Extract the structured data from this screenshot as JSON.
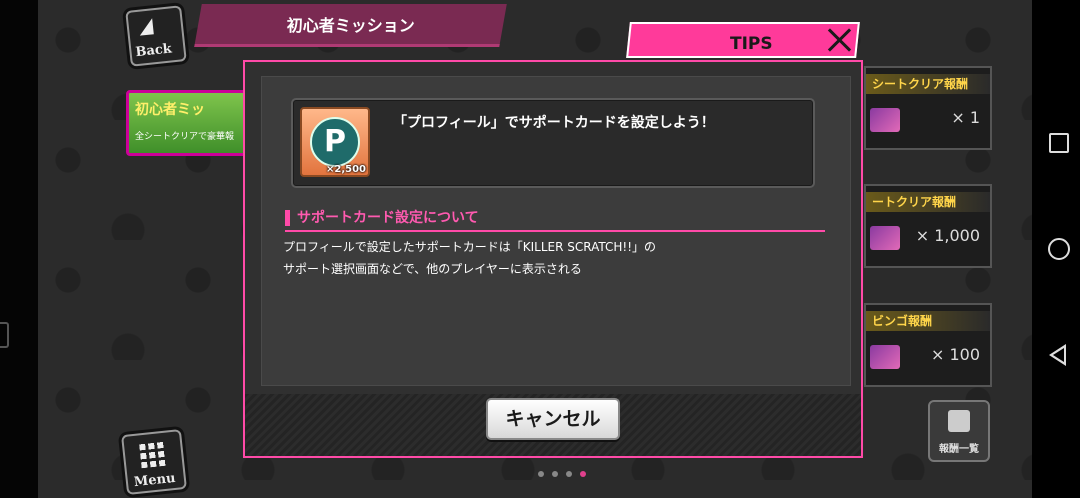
{
  "background": {
    "back_label": "Back",
    "title": "初心者ミッション",
    "mission_banner_title": "初心者ミッ",
    "mission_banner_sub": "全シートクリアで豪華報",
    "menu_label": "Menu",
    "reward_list_label": "報酬一覧",
    "reward_cards": [
      {
        "header": "シートクリア報酬",
        "quantity": "× 1"
      },
      {
        "header": "ートクリア報酬",
        "quantity": "× 1,000"
      },
      {
        "header": "ビンゴ報酬",
        "quantity": "× 100"
      }
    ],
    "page_dots": 4,
    "active_dot": 3
  },
  "tips": {
    "tab_label": "TIPS",
    "close_icon": "close-icon"
  },
  "modal": {
    "item_symbol": "P",
    "item_count": "×2,500",
    "mission_text": "「プロフィール」でサポートカードを設定しよう！",
    "section_title": "サポートカード設定について",
    "desc_line1": "プロフィールで設定したサポートカードは「KILLER SCRATCH!!」の",
    "desc_line2": "サポート選択画面などで、他のプレイヤーに表示される",
    "cancel_label": "キャンセル"
  },
  "colors": {
    "accent_pink": "#ff4aa8",
    "tips_pink": "#ff3a9a",
    "title_bar": "#7a2a52"
  },
  "system_nav": {
    "recents_icon": "square-icon",
    "home_icon": "circle-icon",
    "back_icon": "triangle-back-icon"
  }
}
